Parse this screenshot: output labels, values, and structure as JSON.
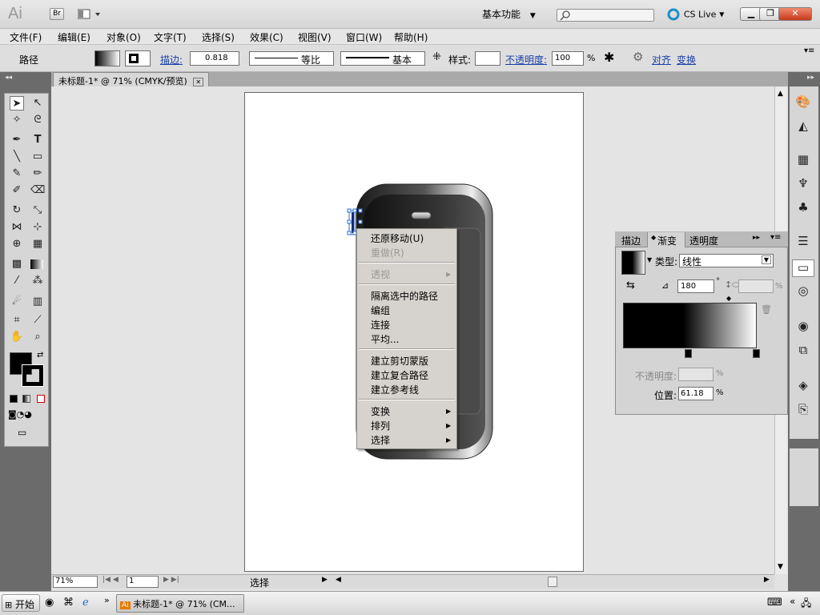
{
  "titlebar": {
    "app_logo": "Ai",
    "bridge_label": "Br",
    "workspace": "基本功能",
    "cs_live": "CS Live",
    "search_placeholder": ""
  },
  "menubar": [
    "文件(F)",
    "编辑(E)",
    "对象(O)",
    "文字(T)",
    "选择(S)",
    "效果(C)",
    "视图(V)",
    "窗口(W)",
    "帮助(H)"
  ],
  "controlbar": {
    "selection_type": "路径",
    "stroke_label": "描边:",
    "stroke_weight": "0.818",
    "stroke_profile": "等比",
    "brush": "基本",
    "style_label": "样式:",
    "opacity_label": "不透明度:",
    "opacity_value": "100",
    "opacity_unit": "%",
    "align_label": "对齐",
    "transform_label": "变换"
  },
  "document_tab": {
    "title": "未标题-1* @ 71% (CMYK/预览)"
  },
  "context_menu": {
    "items": [
      {
        "label": "还原移动(U)",
        "enabled": true
      },
      {
        "label": "重做(R)",
        "enabled": false
      },
      {
        "label": "透视",
        "enabled": false,
        "submenu": true
      },
      {
        "label": "隔离选中的路径",
        "enabled": true
      },
      {
        "label": "编组",
        "enabled": true
      },
      {
        "label": "连接",
        "enabled": true
      },
      {
        "label": "平均...",
        "enabled": true
      },
      {
        "label": "建立剪切蒙版",
        "enabled": true
      },
      {
        "label": "建立复合路径",
        "enabled": true
      },
      {
        "label": "建立参考线",
        "enabled": true
      },
      {
        "label": "变换",
        "enabled": true,
        "submenu": true
      },
      {
        "label": "排列",
        "enabled": true,
        "submenu": true
      },
      {
        "label": "选择",
        "enabled": true,
        "submenu": true
      }
    ]
  },
  "gradient_panel": {
    "tabs": [
      "描边",
      "渐变",
      "透明度"
    ],
    "active_tab": "渐变",
    "type_label": "类型:",
    "type_value": "线性",
    "angle_value": "180",
    "angle_unit": "°",
    "aspect_unit": "%",
    "opacity_label": "不透明度:",
    "opacity_unit": "%",
    "location_label": "位置:",
    "location_value": "61.18",
    "location_unit": "%"
  },
  "statusbar": {
    "zoom": "71%",
    "artboard_number": "1",
    "status_text": "选择"
  },
  "taskbar": {
    "start_label": "开始",
    "task_label": "未标题-1* @ 71% (CM..."
  },
  "colors": {
    "panel_bg": "#d4d4d4",
    "toolbar_dark": "#6b6b6b",
    "link_blue": "#1b3fa8",
    "selection_blue": "#2e6bd6"
  }
}
